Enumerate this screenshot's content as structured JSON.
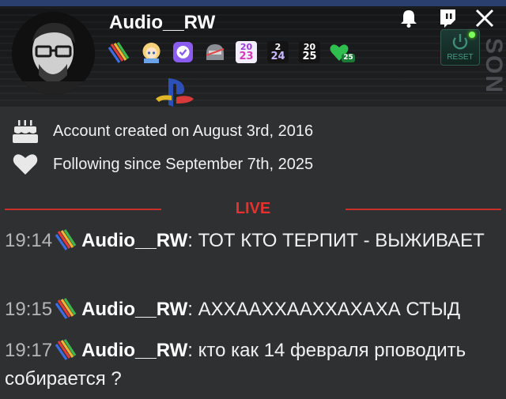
{
  "profile": {
    "username": "Audio__RW",
    "badges": [
      {
        "icon": "rainbow-stripes-badge-icon"
      },
      {
        "icon": "anime-girl-badge-icon"
      },
      {
        "icon": "verified-badge-icon"
      },
      {
        "icon": "helmet-badge-icon"
      },
      {
        "icon": "year-2023-badge-icon",
        "text_top": "20",
        "text_bottom": "23"
      },
      {
        "icon": "year-2024-badge-icon",
        "text_top": "2",
        "text_bottom": "24"
      },
      {
        "icon": "year-2025-badge-icon",
        "text_top": "20",
        "text_bottom": "25"
      },
      {
        "icon": "green-heart-25-badge-icon",
        "text": "25"
      }
    ],
    "reset_label": "RESET",
    "brand_vertical": "SON"
  },
  "info": {
    "account_created": "Account created on August 3rd, 2016",
    "following_since": "Following since September 7th, 2025"
  },
  "live_label": "LIVE",
  "messages": [
    {
      "time": "19:14",
      "user": "Audio__RW",
      "text": "ТОТ КТО ТЕРПИТ - ВЫЖИВАЕТ"
    },
    {
      "time": "19:15",
      "user": "Audio__RW",
      "text": "АХХААХХААХХАХАХА СТЫД"
    },
    {
      "time": "19:17",
      "user": "Audio__RW",
      "text": "кто как 14 февраля рповодить собирается ?"
    }
  ],
  "colors": {
    "live_red": "#e8302e",
    "background": "#2f3032"
  }
}
